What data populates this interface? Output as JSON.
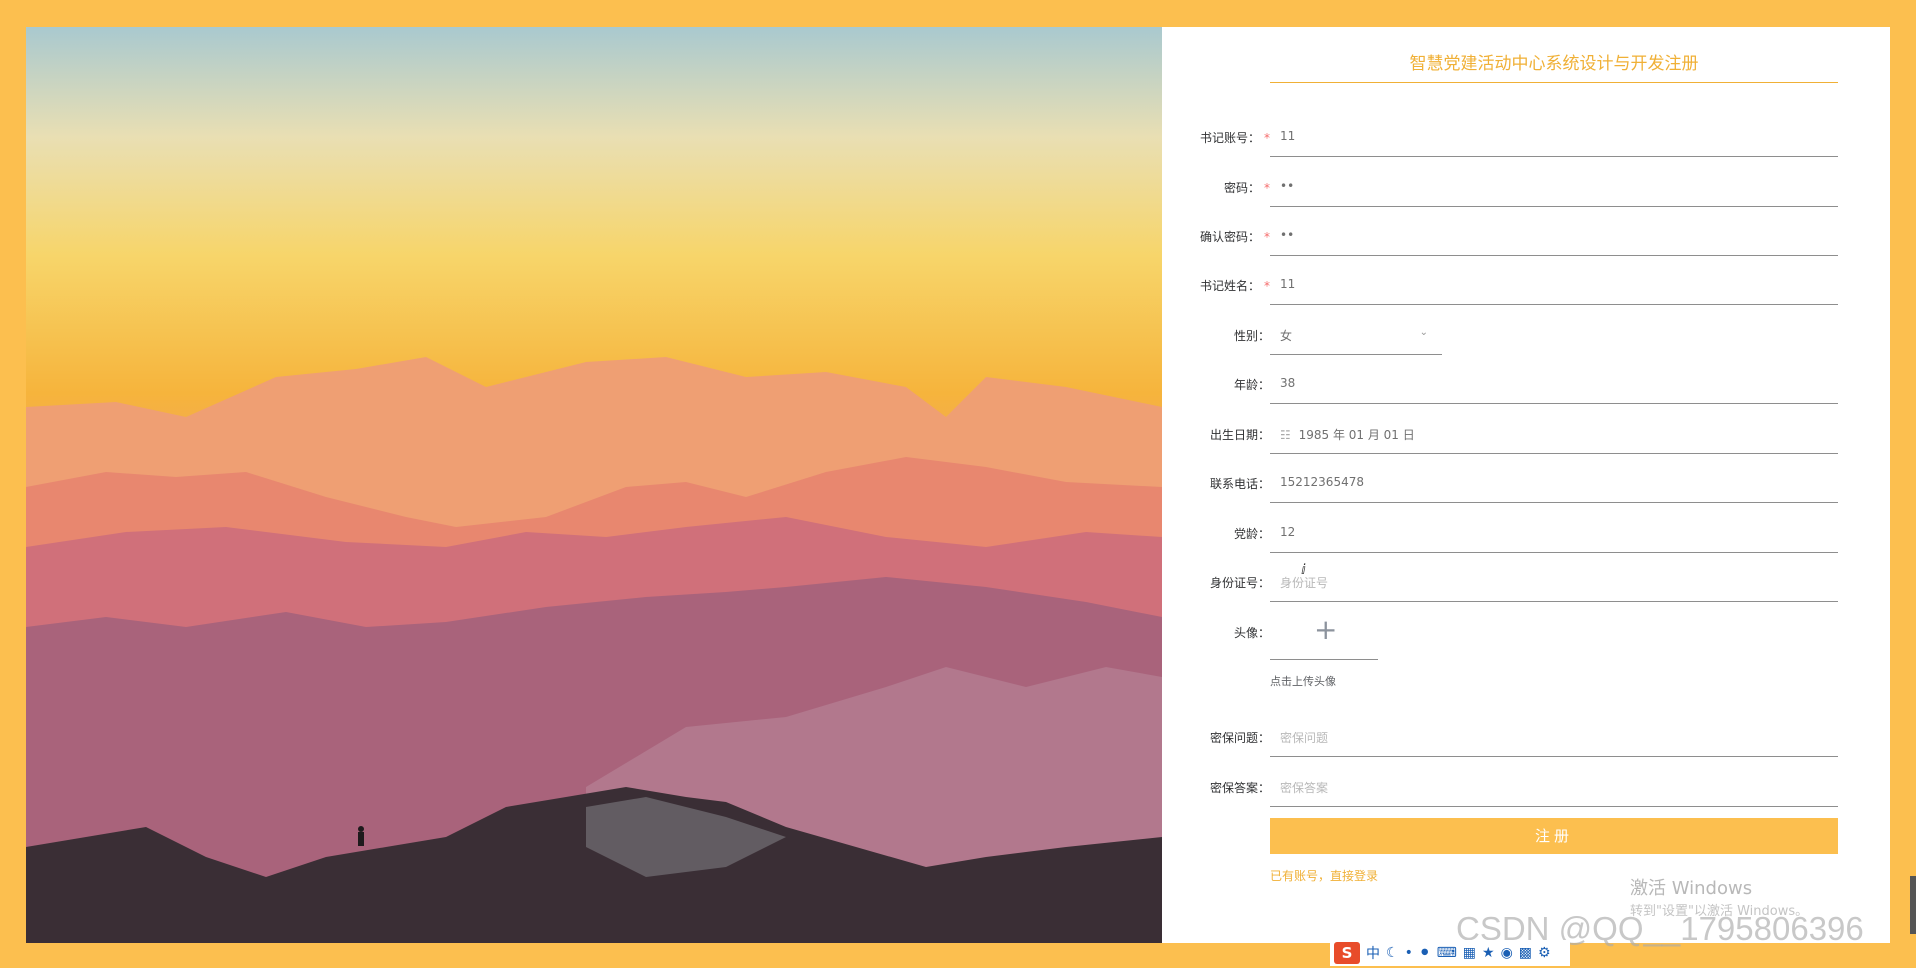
{
  "colors": {
    "accent": "#fcbf4f",
    "title": "#f0b036",
    "required": "#f56c6c"
  },
  "form": {
    "title": "智慧党建活动中心系统设计与开发注册",
    "fields": [
      {
        "label": "书记账号：",
        "required": true,
        "value": "11"
      },
      {
        "label": "密码：",
        "required": true,
        "value": "••"
      },
      {
        "label": "确认密码：",
        "required": true,
        "value": "••"
      },
      {
        "label": "书记姓名：",
        "required": true,
        "value": "11"
      },
      {
        "label": "性别：",
        "required": false,
        "value": "女"
      },
      {
        "label": "年龄：",
        "required": false,
        "value": "38"
      },
      {
        "label": "出生日期：",
        "required": false,
        "value": "1985 年 01 月 01 日"
      },
      {
        "label": "联系电话：",
        "required": false,
        "value": "15212365478"
      },
      {
        "label": "党龄：",
        "required": false,
        "value": "12"
      },
      {
        "label": "身份证号：",
        "required": false,
        "placeholder": "身份证号"
      },
      {
        "label": "头像：",
        "required": false
      },
      {
        "label": "密保问题：",
        "required": false,
        "placeholder": "密保问题"
      },
      {
        "label": "密保答案：",
        "required": false,
        "placeholder": "密保答案"
      }
    ],
    "required_mark": "*",
    "upload_plus": "+",
    "upload_hint": "点击上传头像",
    "submit_label": "注册",
    "login_prefix": "已有账号，",
    "login_link": "直接登录"
  },
  "icons": {
    "select": "chevron-down-icon",
    "date": "calendar-icon",
    "upload": "plus-icon"
  },
  "overlay": {
    "activate_title": "激活 Windows",
    "activate_sub": "转到\"设置\"以激活 Windows。",
    "watermark": "CSDN @QQ__1795806396"
  },
  "tray": {
    "ime": "S",
    "lang": "中"
  }
}
